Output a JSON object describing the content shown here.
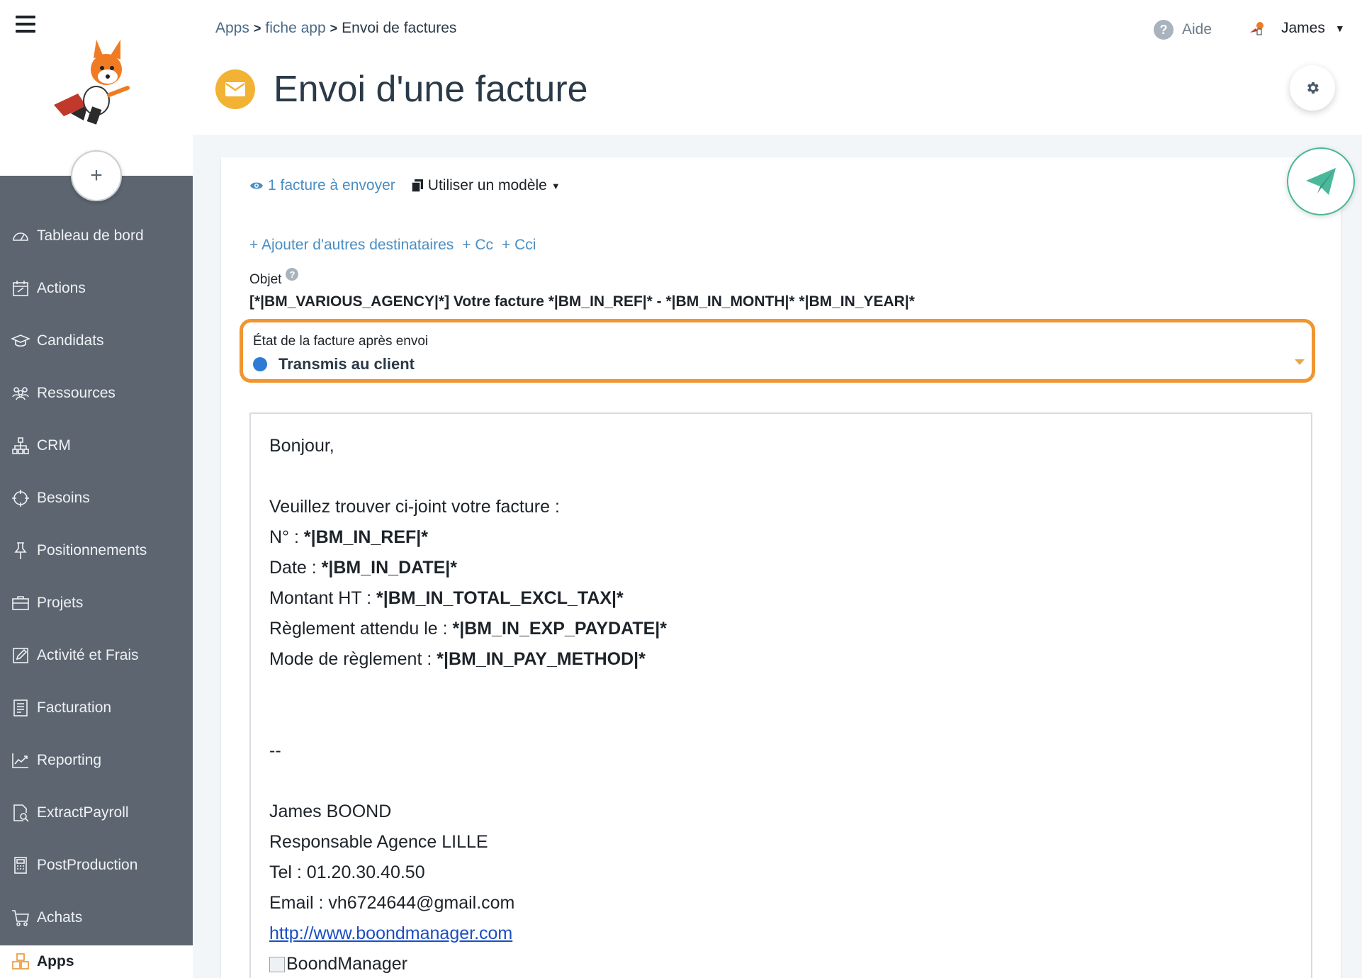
{
  "sidebar": {
    "add_label": "+",
    "items": [
      {
        "label": "Tableau de bord",
        "icon": "dashboard-icon"
      },
      {
        "label": "Actions",
        "icon": "calendar-icon"
      },
      {
        "label": "Candidats",
        "icon": "graduation-cap-icon"
      },
      {
        "label": "Ressources",
        "icon": "users-icon"
      },
      {
        "label": "CRM",
        "icon": "org-chart-icon"
      },
      {
        "label": "Besoins",
        "icon": "crosshair-icon"
      },
      {
        "label": "Positionnements",
        "icon": "pin-icon"
      },
      {
        "label": "Projets",
        "icon": "briefcase-icon"
      },
      {
        "label": "Activité et Frais",
        "icon": "edit-icon"
      },
      {
        "label": "Facturation",
        "icon": "invoice-icon"
      },
      {
        "label": "Reporting",
        "icon": "chart-icon"
      },
      {
        "label": "ExtractPayroll",
        "icon": "document-search-icon"
      },
      {
        "label": "PostProduction",
        "icon": "calculator-icon"
      },
      {
        "label": "Achats",
        "icon": "cart-icon"
      }
    ],
    "apps_label": "Apps"
  },
  "header": {
    "breadcrumb": [
      "Apps",
      "fiche app",
      "Envoi de factures"
    ],
    "title": "Envoi d'une facture",
    "help_label": "Aide",
    "user_name": "James"
  },
  "toolbar": {
    "to_send_label": "1 facture à envoyer",
    "template_label": "Utiliser un modèle"
  },
  "recipients": {
    "add_others": "+ Ajouter d'autres destinataires",
    "cc": "+ Cc",
    "bcc": "+ Cci"
  },
  "subject": {
    "label": "Objet",
    "help": "?",
    "value": "[*|BM_VARIOUS_AGENCY|*] Votre facture *|BM_IN_REF|* - *|BM_IN_MONTH|* *|BM_IN_YEAR|*"
  },
  "state": {
    "label": "État de la facture après envoi",
    "value": "Transmis au client",
    "dot_color": "#2e7bd6"
  },
  "email_body": {
    "greeting": "Bonjour,",
    "intro": "Veuillez trouver ci-joint votre facture :",
    "fields": [
      {
        "label": "N° : ",
        "value": "*|BM_IN_REF|*"
      },
      {
        "label": "Date : ",
        "value": "*|BM_IN_DATE|*"
      },
      {
        "label": "Montant HT : ",
        "value": "*|BM_IN_TOTAL_EXCL_TAX|*"
      },
      {
        "label": "Règlement attendu le : ",
        "value": "*|BM_IN_EXP_PAYDATE|*"
      },
      {
        "label": "Mode de règlement : ",
        "value": "*|BM_IN_PAY_METHOD|*"
      }
    ],
    "signature_sep": "--",
    "sig_name": "James BOOND",
    "sig_role": "Responsable Agence LILLE",
    "sig_tel": "Tel : 01.20.30.40.50",
    "sig_email": "Email : vh6724644@gmail.com",
    "sig_link": "http://www.boondmanager.com",
    "sig_img_alt": "BoondManager"
  },
  "colors": {
    "sidebar_bg": "#5d6670",
    "highlight_border": "#f0952f",
    "title_icon": "#f2b233",
    "link": "#4a8ec2",
    "send_accent": "#4ab89a"
  }
}
